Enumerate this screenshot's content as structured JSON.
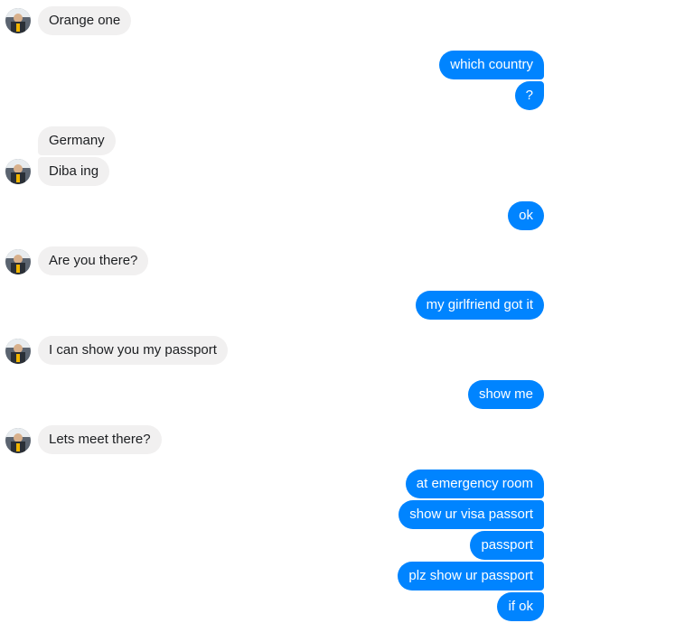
{
  "colors": {
    "incoming_bubble": "#f1f0f0",
    "incoming_text": "#1c1e21",
    "outgoing_bubble": "#0084ff",
    "outgoing_text": "#ffffff"
  },
  "avatar_icon": "contact-avatar-icon",
  "messages": [
    {
      "from": "them",
      "text": "Orange one"
    },
    {
      "from": "me",
      "text": "which country"
    },
    {
      "from": "me",
      "text": "?"
    },
    {
      "from": "them",
      "text": "Germany"
    },
    {
      "from": "them",
      "text": "Diba ing"
    },
    {
      "from": "me",
      "text": "ok"
    },
    {
      "from": "them",
      "text": "Are you there?"
    },
    {
      "from": "me",
      "text": "my girlfriend got it"
    },
    {
      "from": "them",
      "text": "I can show you my passport"
    },
    {
      "from": "me",
      "text": "show me"
    },
    {
      "from": "them",
      "text": "Lets meet there?"
    },
    {
      "from": "me",
      "text": "at emergency room"
    },
    {
      "from": "me",
      "text": "show ur visa passort"
    },
    {
      "from": "me",
      "text": "passport"
    },
    {
      "from": "me",
      "text": "plz show ur passport"
    },
    {
      "from": "me",
      "text": "if ok"
    }
  ]
}
